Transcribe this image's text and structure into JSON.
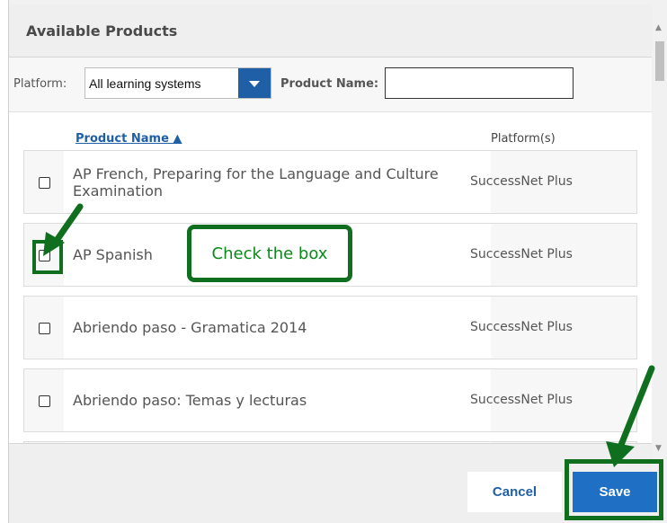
{
  "dialog": {
    "title": "Available Products"
  },
  "filters": {
    "platform_label": "Platform:",
    "platform_value": "All learning systems",
    "product_name_label": "Product Name:",
    "product_name_value": ""
  },
  "table": {
    "columns": [
      "Product Name ▲",
      "Platform(s)"
    ],
    "rows": [
      {
        "name": "AP French, Preparing for the Language and Culture Examination",
        "platform": "SuccessNet Plus",
        "checked": false
      },
      {
        "name": "AP Spanish",
        "platform": "SuccessNet Plus",
        "checked": false
      },
      {
        "name": "Abriendo paso - Gramatica 2014",
        "platform": "SuccessNet Plus",
        "checked": false
      },
      {
        "name": "Abriendo paso: Temas y lecturas",
        "platform": "SuccessNet Plus",
        "checked": false
      }
    ]
  },
  "annotation": {
    "callout_text": "Check the box",
    "color": "#0f6f1f"
  },
  "footer": {
    "cancel_label": "Cancel",
    "save_label": "Save"
  },
  "colors": {
    "accent": "#1f5fa6",
    "save": "#1f6fc4",
    "highlight": "#0f6f1f"
  },
  "icons": {
    "dropdown": "chevron-down-icon",
    "sort": "sort-up-icon",
    "scroll_up": "scroll-up-icon",
    "scroll_down": "scroll-down-icon"
  }
}
